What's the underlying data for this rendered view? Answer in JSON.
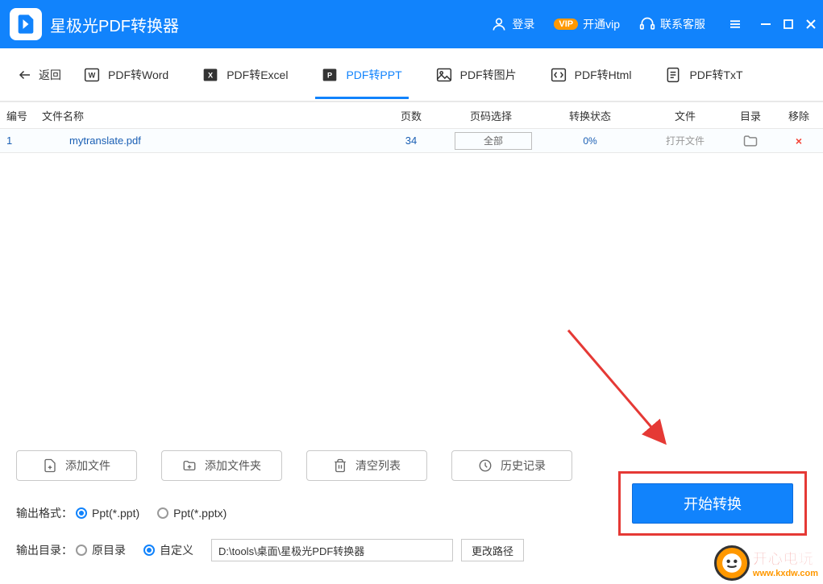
{
  "app": {
    "title": "星极光PDF转换器"
  },
  "titlebar": {
    "login": "登录",
    "vip": "开通vip",
    "support": "联系客服"
  },
  "tabs": {
    "back": "返回",
    "items": [
      {
        "label": "PDF转Word"
      },
      {
        "label": "PDF转Excel"
      },
      {
        "label": "PDF转PPT",
        "active": true
      },
      {
        "label": "PDF转图片"
      },
      {
        "label": "PDF转Html"
      },
      {
        "label": "PDF转TxT"
      }
    ]
  },
  "table": {
    "headers": {
      "id": "编号",
      "name": "文件名称",
      "pages": "页数",
      "range": "页码选择",
      "status": "转换状态",
      "file": "文件",
      "dir": "目录",
      "del": "移除"
    },
    "rows": [
      {
        "id": "1",
        "name": "mytranslate.pdf",
        "pages": "34",
        "range": "全部",
        "status": "0%",
        "file": "打开文件"
      }
    ]
  },
  "actions": {
    "addFile": "添加文件",
    "addFolder": "添加文件夹",
    "clear": "清空列表",
    "history": "历史记录"
  },
  "output": {
    "formatLabel": "输出格式：",
    "format1": "Ppt(*.ppt)",
    "format2": "Ppt(*.pptx)",
    "dirLabel": "输出目录：",
    "origDir": "原目录",
    "custom": "自定义",
    "path": "D:\\tools\\桌面\\星极光PDF转换器",
    "changePath": "更改路径"
  },
  "start": "开始转换",
  "watermark": {
    "cn": "开心电玩",
    "url": "www.kxdw.com"
  }
}
